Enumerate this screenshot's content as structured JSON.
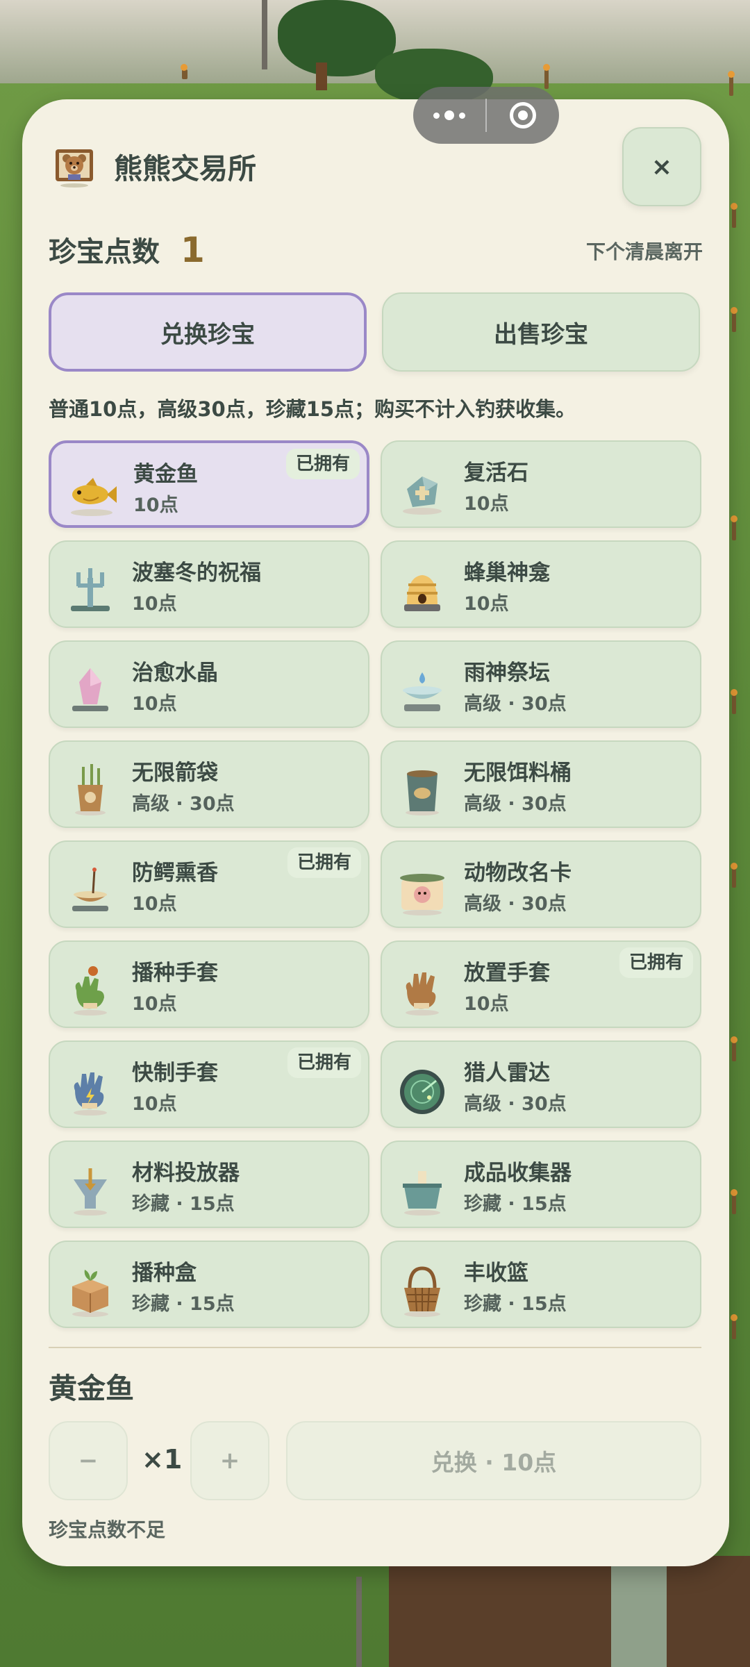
{
  "header": {
    "title": "熊熊交易所",
    "close_label": "×",
    "bear_icon": "bear-portrait-icon"
  },
  "points": {
    "label": "珍宝点数",
    "value": "1",
    "leave_text": "下个清晨离开"
  },
  "tabs": [
    {
      "label": "兑换珍宝",
      "active": true
    },
    {
      "label": "出售珍宝",
      "active": false
    }
  ],
  "note": "普通10点，高级30点，珍藏15点；购买不计入钓获收集。",
  "owned_label": "已拥有",
  "items": [
    {
      "name": "黄金鱼",
      "price": "10点",
      "owned": true,
      "selected": true,
      "icon": "golden-fish-icon"
    },
    {
      "name": "复活石",
      "price": "10点",
      "owned": false,
      "icon": "revival-stone-icon"
    },
    {
      "name": "波塞冬的祝福",
      "price": "10点",
      "owned": false,
      "icon": "trident-icon"
    },
    {
      "name": "蜂巢神龛",
      "price": "10点",
      "owned": false,
      "icon": "beehive-shrine-icon"
    },
    {
      "name": "治愈水晶",
      "price": "10点",
      "owned": false,
      "icon": "healing-crystal-icon"
    },
    {
      "name": "雨神祭坛",
      "price": "高级 · 30点",
      "owned": false,
      "icon": "rain-altar-icon"
    },
    {
      "name": "无限箭袋",
      "price": "高级 · 30点",
      "owned": false,
      "icon": "quiver-icon"
    },
    {
      "name": "无限饵料桶",
      "price": "高级 · 30点",
      "owned": false,
      "icon": "bait-bucket-icon"
    },
    {
      "name": "防鳄熏香",
      "price": "10点",
      "owned": true,
      "icon": "incense-icon"
    },
    {
      "name": "动物改名卡",
      "price": "高级 · 30点",
      "owned": false,
      "icon": "rename-card-icon"
    },
    {
      "name": "播种手套",
      "price": "10点",
      "owned": false,
      "icon": "sowing-glove-icon"
    },
    {
      "name": "放置手套",
      "price": "10点",
      "owned": true,
      "icon": "placing-glove-icon"
    },
    {
      "name": "快制手套",
      "price": "10点",
      "owned": true,
      "icon": "crafting-glove-icon"
    },
    {
      "name": "猎人雷达",
      "price": "高级 · 30点",
      "owned": false,
      "icon": "radar-icon"
    },
    {
      "name": "材料投放器",
      "price": "珍藏 · 15点",
      "owned": false,
      "icon": "dispenser-icon"
    },
    {
      "name": "成品收集器",
      "price": "珍藏 · 15点",
      "owned": false,
      "icon": "collector-icon"
    },
    {
      "name": "播种盒",
      "price": "珍藏 · 15点",
      "owned": false,
      "icon": "seed-box-icon"
    },
    {
      "name": "丰收篮",
      "price": "珍藏 · 15点",
      "owned": false,
      "icon": "harvest-basket-icon"
    }
  ],
  "selection": {
    "name": "黄金鱼",
    "minus_label": "−",
    "plus_label": "+",
    "quantity": "×1",
    "redeem_label": "兑换 · 10点",
    "warning": "珍宝点数不足"
  },
  "colors": {
    "panel": "#f4f1e3",
    "card": "#dbe8d4",
    "selected_card": "#e6e0ef",
    "selected_border": "#9a88c7",
    "text": "#3c4a44",
    "points_accent": "#8a6a2e"
  }
}
